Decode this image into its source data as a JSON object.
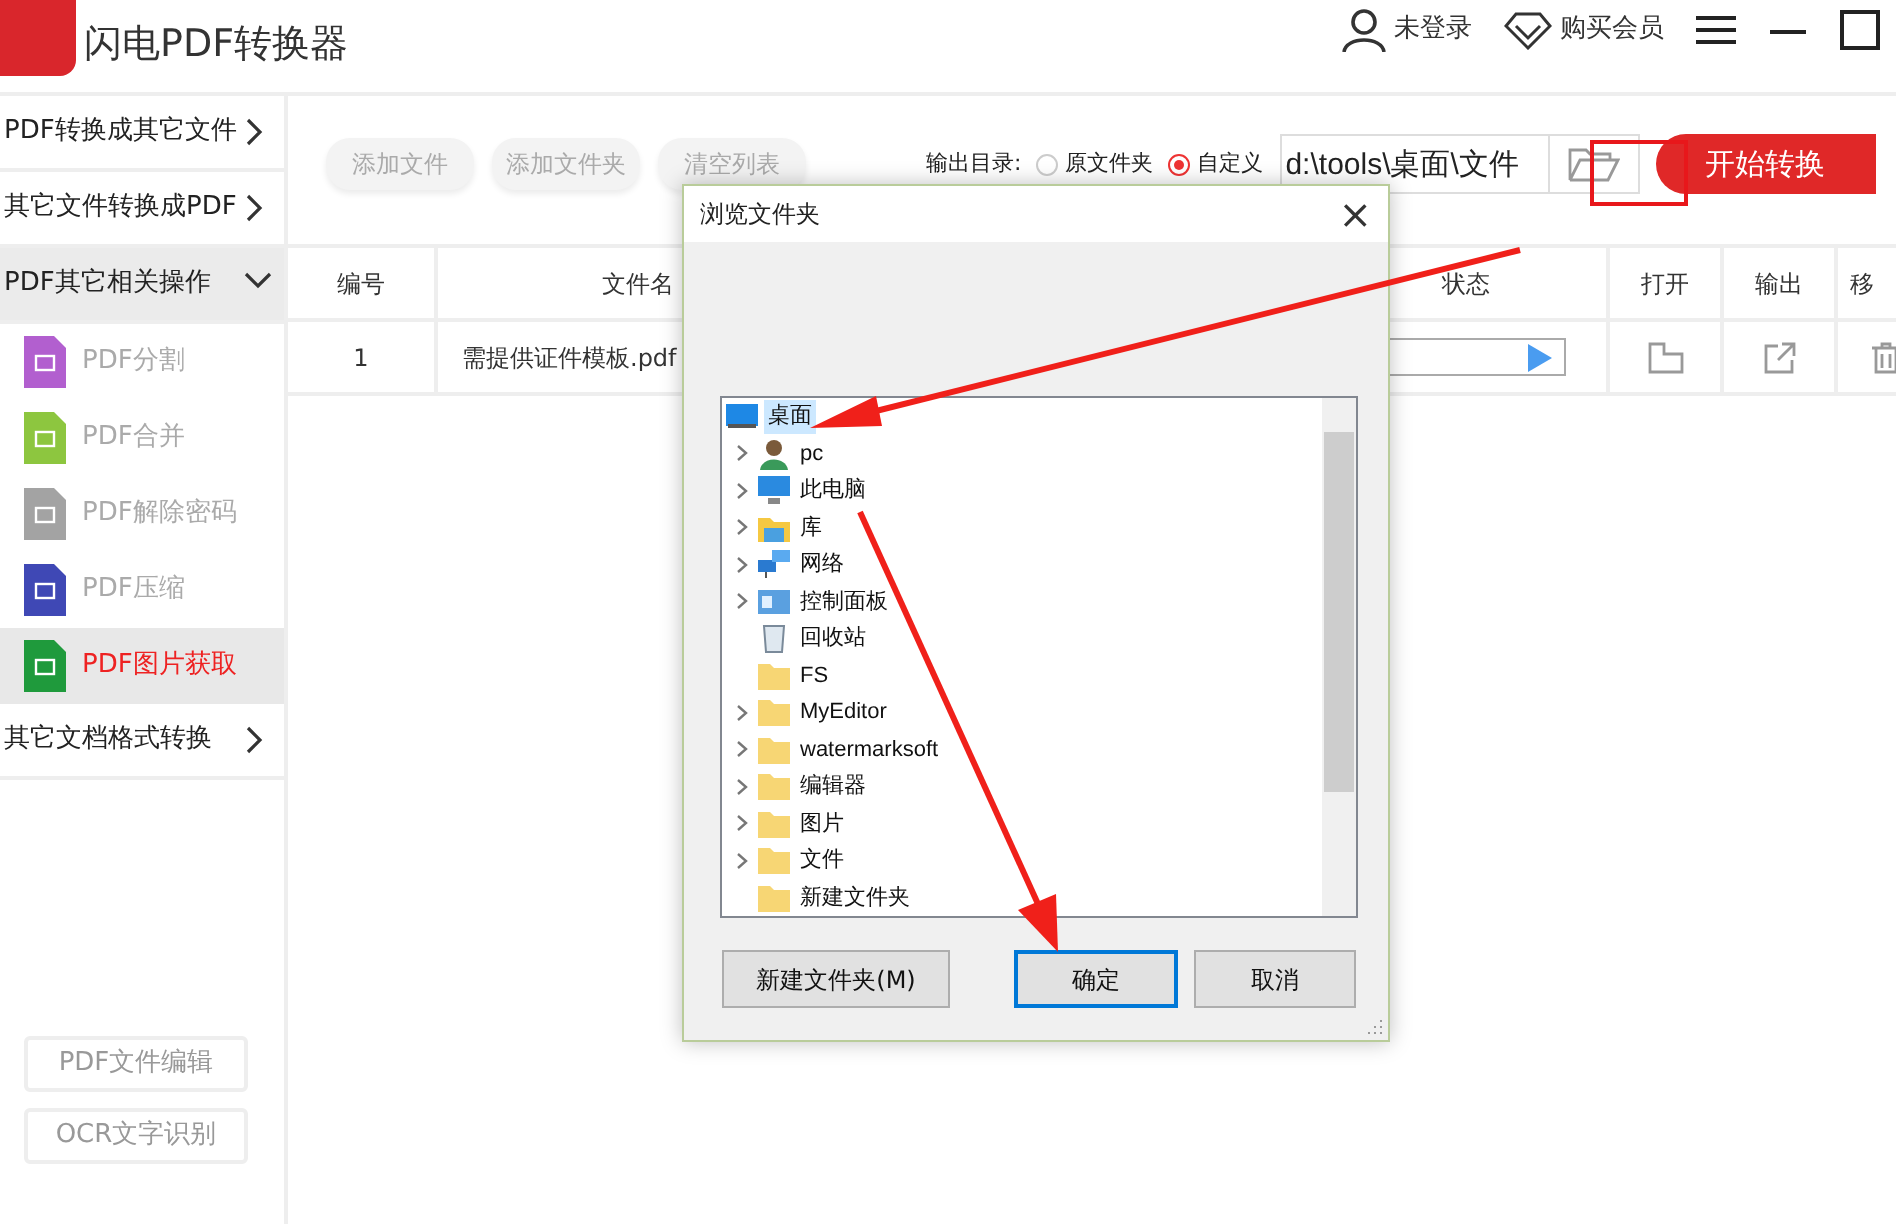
{
  "app": {
    "title": "闪电PDF转换器"
  },
  "header_actions": [
    {
      "kind": "user",
      "label": "未登录"
    },
    {
      "kind": "vip",
      "label": "购买会员"
    }
  ],
  "sidebar": {
    "sections": [
      {
        "label": "PDF转换成其它文件",
        "expanded": false
      },
      {
        "label": "其它文件转换成PDF",
        "expanded": false
      },
      {
        "label": "PDF其它相关操作",
        "expanded": true,
        "children": [
          {
            "label": "PDF分割",
            "color": "#b25fcf",
            "selected": false
          },
          {
            "label": "PDF合并",
            "color": "#8dc63f",
            "selected": false
          },
          {
            "label": "PDF解除密码",
            "color": "#a3a3a3",
            "selected": false
          },
          {
            "label": "PDF压缩",
            "color": "#3f48b5",
            "selected": false
          },
          {
            "label": "PDF图片获取",
            "color": "#1f9a3c",
            "selected": true
          }
        ]
      },
      {
        "label": "其它文档格式转换",
        "expanded": false
      }
    ],
    "buttons": [
      "PDF文件编辑",
      "OCR文字识别"
    ]
  },
  "toolbar": {
    "buttons": [
      "添加文件",
      "添加文件夹",
      "清空列表"
    ],
    "output_label": "输出目录:",
    "output_options": [
      {
        "label": "原文件夹",
        "selected": false
      },
      {
        "label": "自定义",
        "selected": true
      }
    ],
    "path": "d:\\tools\\桌面\\文件",
    "start_button": "开始转换"
  },
  "table": {
    "columns": [
      "编号",
      "文件名",
      "状态",
      "打开",
      "输出",
      "移"
    ],
    "rows": [
      {
        "number": "1",
        "file": "需提供证件模板.pdf",
        "level": 0
      }
    ]
  },
  "dialog": {
    "title": "浏览文件夹",
    "close": "×",
    "tree": [
      {
        "label": "桌面",
        "kind": "desktop",
        "selected": true,
        "expandable": false,
        "children": [
          {
            "label": "pc",
            "kind": "user",
            "selected": false,
            "expandable": true
          },
          {
            "label": "此电脑",
            "kind": "computer",
            "selected": false,
            "expandable": true
          },
          {
            "label": "库",
            "kind": "library",
            "selected": false,
            "expandable": true
          },
          {
            "label": "网络",
            "kind": "network",
            "selected": false,
            "expandable": true
          },
          {
            "label": "控制面板",
            "kind": "control-panel",
            "selected": false,
            "expandable": true
          },
          {
            "label": "回收站",
            "kind": "recycle-bin",
            "selected": false,
            "expandable": false
          },
          {
            "label": "FS",
            "kind": "folder",
            "selected": false,
            "expandable": false
          },
          {
            "label": "MyEditor",
            "kind": "folder",
            "selected": false,
            "expandable": true
          },
          {
            "label": "watermarksoft",
            "kind": "folder",
            "selected": false,
            "expandable": true
          },
          {
            "label": "编辑器",
            "kind": "folder",
            "selected": false,
            "expandable": true
          },
          {
            "label": "图片",
            "kind": "folder",
            "selected": false,
            "expandable": true
          },
          {
            "label": "文件",
            "kind": "folder",
            "selected": false,
            "expandable": true
          },
          {
            "label": "新建文件夹",
            "kind": "folder",
            "selected": false,
            "expandable": false
          }
        ]
      }
    ],
    "buttons": [
      {
        "label": "新建文件夹(M)",
        "focused": false
      },
      {
        "label": "确定",
        "focused": true
      },
      {
        "label": "取消",
        "focused": false
      }
    ]
  }
}
